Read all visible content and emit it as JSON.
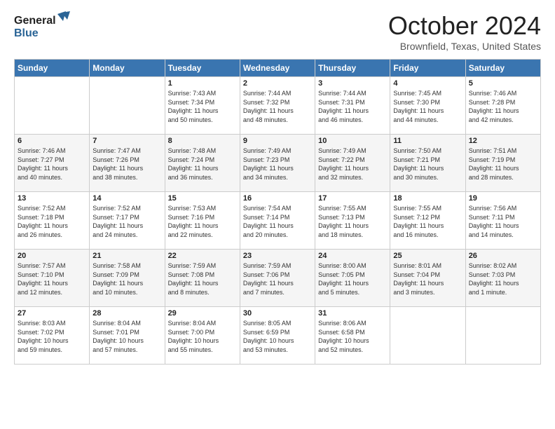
{
  "header": {
    "logo_general": "General",
    "logo_blue": "Blue",
    "month_title": "October 2024",
    "location": "Brownfield, Texas, United States"
  },
  "days_of_week": [
    "Sunday",
    "Monday",
    "Tuesday",
    "Wednesday",
    "Thursday",
    "Friday",
    "Saturday"
  ],
  "weeks": [
    [
      {
        "day": "",
        "info": ""
      },
      {
        "day": "",
        "info": ""
      },
      {
        "day": "1",
        "info": "Sunrise: 7:43 AM\nSunset: 7:34 PM\nDaylight: 11 hours\nand 50 minutes."
      },
      {
        "day": "2",
        "info": "Sunrise: 7:44 AM\nSunset: 7:32 PM\nDaylight: 11 hours\nand 48 minutes."
      },
      {
        "day": "3",
        "info": "Sunrise: 7:44 AM\nSunset: 7:31 PM\nDaylight: 11 hours\nand 46 minutes."
      },
      {
        "day": "4",
        "info": "Sunrise: 7:45 AM\nSunset: 7:30 PM\nDaylight: 11 hours\nand 44 minutes."
      },
      {
        "day": "5",
        "info": "Sunrise: 7:46 AM\nSunset: 7:28 PM\nDaylight: 11 hours\nand 42 minutes."
      }
    ],
    [
      {
        "day": "6",
        "info": "Sunrise: 7:46 AM\nSunset: 7:27 PM\nDaylight: 11 hours\nand 40 minutes."
      },
      {
        "day": "7",
        "info": "Sunrise: 7:47 AM\nSunset: 7:26 PM\nDaylight: 11 hours\nand 38 minutes."
      },
      {
        "day": "8",
        "info": "Sunrise: 7:48 AM\nSunset: 7:24 PM\nDaylight: 11 hours\nand 36 minutes."
      },
      {
        "day": "9",
        "info": "Sunrise: 7:49 AM\nSunset: 7:23 PM\nDaylight: 11 hours\nand 34 minutes."
      },
      {
        "day": "10",
        "info": "Sunrise: 7:49 AM\nSunset: 7:22 PM\nDaylight: 11 hours\nand 32 minutes."
      },
      {
        "day": "11",
        "info": "Sunrise: 7:50 AM\nSunset: 7:21 PM\nDaylight: 11 hours\nand 30 minutes."
      },
      {
        "day": "12",
        "info": "Sunrise: 7:51 AM\nSunset: 7:19 PM\nDaylight: 11 hours\nand 28 minutes."
      }
    ],
    [
      {
        "day": "13",
        "info": "Sunrise: 7:52 AM\nSunset: 7:18 PM\nDaylight: 11 hours\nand 26 minutes."
      },
      {
        "day": "14",
        "info": "Sunrise: 7:52 AM\nSunset: 7:17 PM\nDaylight: 11 hours\nand 24 minutes."
      },
      {
        "day": "15",
        "info": "Sunrise: 7:53 AM\nSunset: 7:16 PM\nDaylight: 11 hours\nand 22 minutes."
      },
      {
        "day": "16",
        "info": "Sunrise: 7:54 AM\nSunset: 7:14 PM\nDaylight: 11 hours\nand 20 minutes."
      },
      {
        "day": "17",
        "info": "Sunrise: 7:55 AM\nSunset: 7:13 PM\nDaylight: 11 hours\nand 18 minutes."
      },
      {
        "day": "18",
        "info": "Sunrise: 7:55 AM\nSunset: 7:12 PM\nDaylight: 11 hours\nand 16 minutes."
      },
      {
        "day": "19",
        "info": "Sunrise: 7:56 AM\nSunset: 7:11 PM\nDaylight: 11 hours\nand 14 minutes."
      }
    ],
    [
      {
        "day": "20",
        "info": "Sunrise: 7:57 AM\nSunset: 7:10 PM\nDaylight: 11 hours\nand 12 minutes."
      },
      {
        "day": "21",
        "info": "Sunrise: 7:58 AM\nSunset: 7:09 PM\nDaylight: 11 hours\nand 10 minutes."
      },
      {
        "day": "22",
        "info": "Sunrise: 7:59 AM\nSunset: 7:08 PM\nDaylight: 11 hours\nand 8 minutes."
      },
      {
        "day": "23",
        "info": "Sunrise: 7:59 AM\nSunset: 7:06 PM\nDaylight: 11 hours\nand 7 minutes."
      },
      {
        "day": "24",
        "info": "Sunrise: 8:00 AM\nSunset: 7:05 PM\nDaylight: 11 hours\nand 5 minutes."
      },
      {
        "day": "25",
        "info": "Sunrise: 8:01 AM\nSunset: 7:04 PM\nDaylight: 11 hours\nand 3 minutes."
      },
      {
        "day": "26",
        "info": "Sunrise: 8:02 AM\nSunset: 7:03 PM\nDaylight: 11 hours\nand 1 minute."
      }
    ],
    [
      {
        "day": "27",
        "info": "Sunrise: 8:03 AM\nSunset: 7:02 PM\nDaylight: 10 hours\nand 59 minutes."
      },
      {
        "day": "28",
        "info": "Sunrise: 8:04 AM\nSunset: 7:01 PM\nDaylight: 10 hours\nand 57 minutes."
      },
      {
        "day": "29",
        "info": "Sunrise: 8:04 AM\nSunset: 7:00 PM\nDaylight: 10 hours\nand 55 minutes."
      },
      {
        "day": "30",
        "info": "Sunrise: 8:05 AM\nSunset: 6:59 PM\nDaylight: 10 hours\nand 53 minutes."
      },
      {
        "day": "31",
        "info": "Sunrise: 8:06 AM\nSunset: 6:58 PM\nDaylight: 10 hours\nand 52 minutes."
      },
      {
        "day": "",
        "info": ""
      },
      {
        "day": "",
        "info": ""
      }
    ]
  ]
}
